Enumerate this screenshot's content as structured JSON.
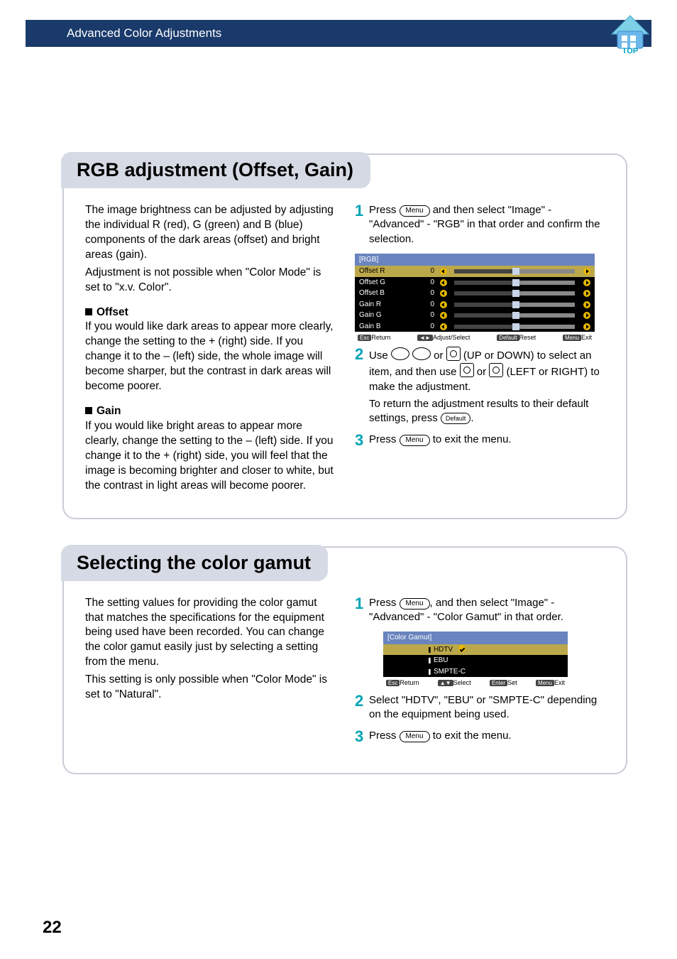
{
  "header": {
    "title": "Advanced Color Adjustments"
  },
  "top_logo_label": "TOP",
  "page_number": "22",
  "buttons": {
    "menu": "Menu",
    "default": "Default"
  },
  "section1": {
    "title": "RGB adjustment (Offset, Gain)",
    "intro": "The image brightness can be adjusted by adjusting the individual R (red), G (green) and B (blue) components of the dark areas (offset) and bright areas (gain).",
    "note": "Adjustment is not possible when \"Color Mode\" is set to \"x.v. Color\".",
    "offset_head": "Offset",
    "offset_body": "If you would like dark areas to appear more clearly, change the setting to the + (right) side. If you change it to the – (left) side, the whole image will become sharper, but the contrast in dark areas will become poorer.",
    "gain_head": "Gain",
    "gain_body": "If you would like bright areas to appear more clearly, change the setting to the – (left) side. If you change it to the + (right) side, you will feel that the image is becoming brighter and closer to white, but the contrast in light areas will become poorer.",
    "step1_a": "Press ",
    "step1_b": " and then select \"Image\" - \"Advanced\" - \"RGB\" in that order and confirm the selection.",
    "step2_a": "Use ",
    "step2_b": " or ",
    "step2_c": " (UP or DOWN) to select an item, and then use ",
    "step2_d": " or ",
    "step2_e": " (LEFT or RIGHT) to make the adjustment.",
    "step2_note": "To return the adjustment results to their default settings, press ",
    "step2_note_end": ".",
    "step3_a": "Press ",
    "step3_b": " to exit the menu."
  },
  "rgb_menu": {
    "title": "[RGB]",
    "rows": [
      {
        "label": "Offset R",
        "val": "0"
      },
      {
        "label": "Offset G",
        "val": "0"
      },
      {
        "label": "Offset B",
        "val": "0"
      },
      {
        "label": "Gain R",
        "val": "0"
      },
      {
        "label": "Gain G",
        "val": "0"
      },
      {
        "label": "Gain B",
        "val": "0"
      }
    ],
    "footer": {
      "esc": "Esc",
      "ret": "Return",
      "adj": "Adjust/Select",
      "def": "Default",
      "reset": "Reset",
      "menu": "Menu",
      "exit": "Exit"
    }
  },
  "section2": {
    "title": "Selecting the color gamut",
    "intro": "The setting values for providing the color gamut that matches the specifications for the equipment being used have been recorded. You can change the color gamut easily just by selecting a setting from the menu.",
    "note": "This setting is only possible when \"Color Mode\" is set to \"Natural\".",
    "step1_a": "Press ",
    "step1_b": ", and then select \"Image\" - \"Advanced\" - \"Color Gamut\" in that order.",
    "step2": "Select \"HDTV\", \"EBU\" or \"SMPTE-C\" depending on the equipment being used.",
    "step3_a": "Press ",
    "step3_b": " to exit the menu."
  },
  "gamut_menu": {
    "title": "[Color Gamut]",
    "options": [
      "HDTV",
      "EBU",
      "SMPTE-C"
    ],
    "footer": {
      "esc": "Esc",
      "ret": "Return",
      "sel": "Select",
      "ent": "Enter",
      "set": "Set",
      "menu": "Menu",
      "exit": "Exit"
    }
  }
}
